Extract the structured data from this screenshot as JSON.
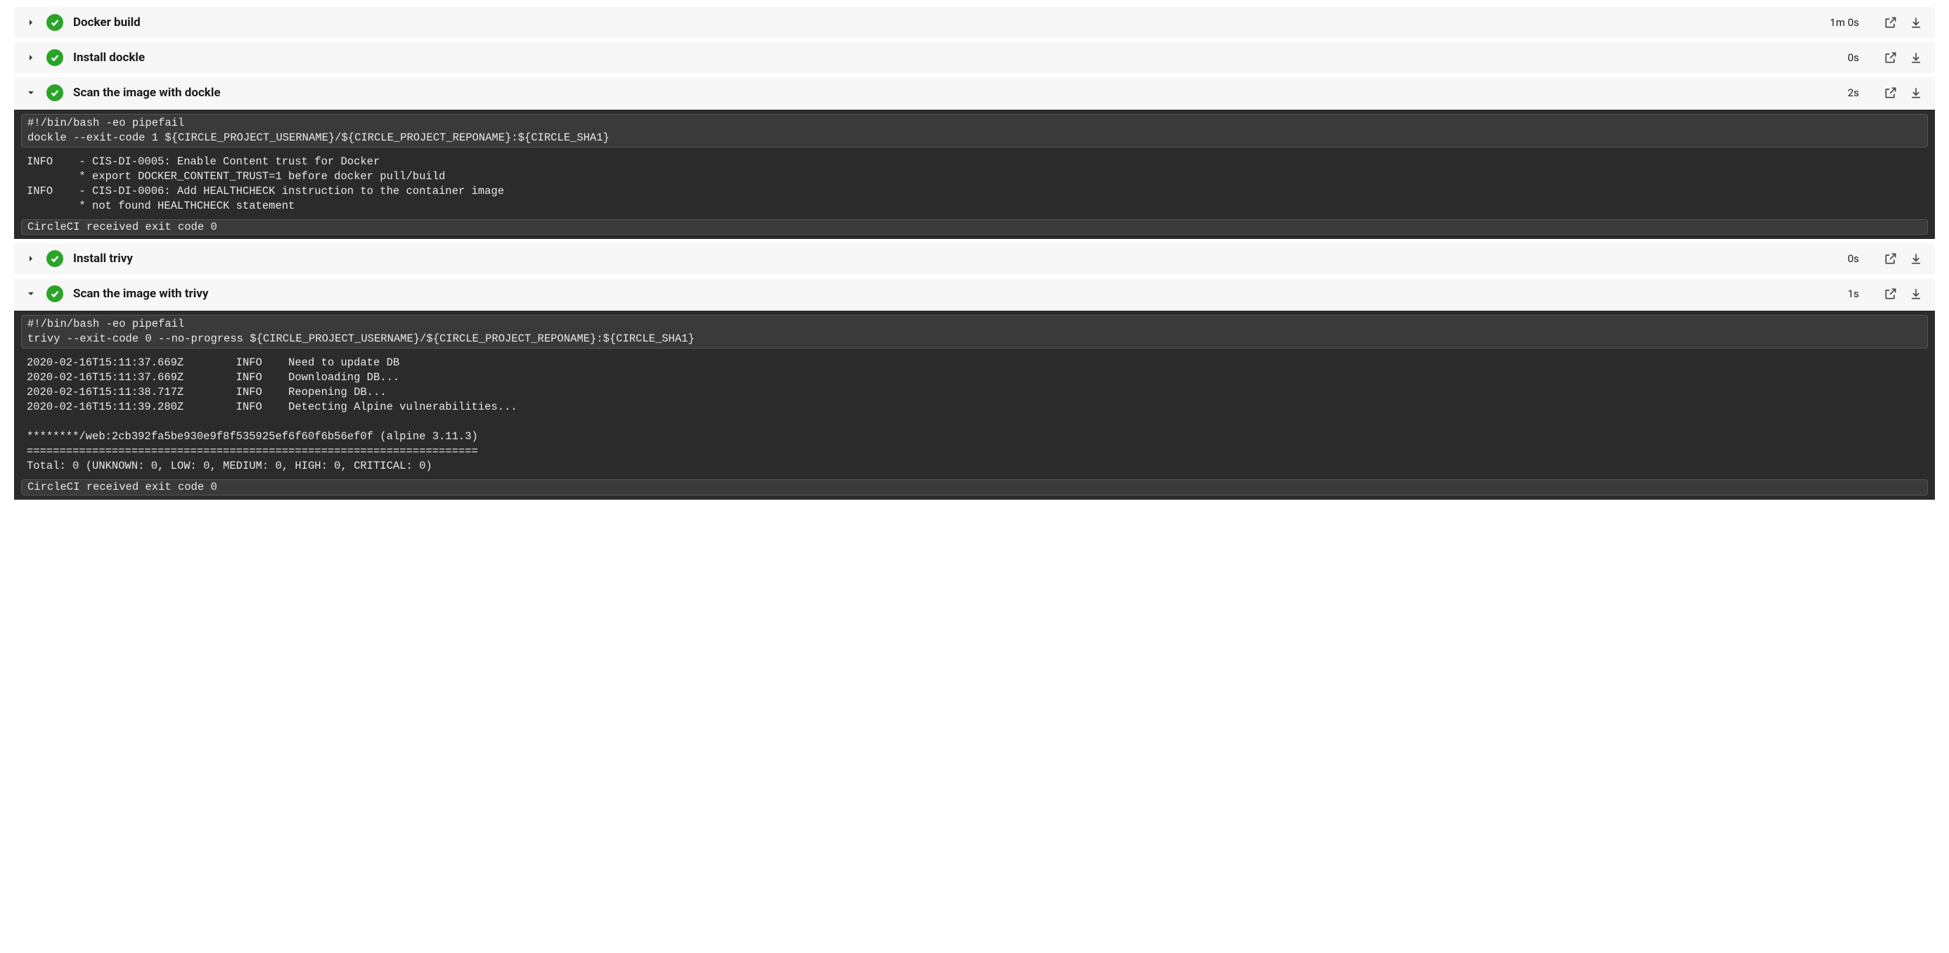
{
  "steps": [
    {
      "title": "Docker build",
      "duration": "1m 0s",
      "expanded": false
    },
    {
      "title": "Install dockle",
      "duration": "0s",
      "expanded": false
    },
    {
      "title": "Scan the image with dockle",
      "duration": "2s",
      "expanded": true,
      "command": "#!/bin/bash -eo pipefail\ndockle --exit-code 1 ${CIRCLE_PROJECT_USERNAME}/${CIRCLE_PROJECT_REPONAME}:${CIRCLE_SHA1}",
      "output": "INFO    - CIS-DI-0005: Enable Content trust for Docker\n        * export DOCKER_CONTENT_TRUST=1 before docker pull/build\nINFO    - CIS-DI-0006: Add HEALTHCHECK instruction to the container image\n        * not found HEALTHCHECK statement",
      "footer": "CircleCI received exit code 0"
    },
    {
      "title": "Install trivy",
      "duration": "0s",
      "expanded": false
    },
    {
      "title": "Scan the image with trivy",
      "duration": "1s",
      "expanded": true,
      "command": "#!/bin/bash -eo pipefail\ntrivy --exit-code 0 --no-progress ${CIRCLE_PROJECT_USERNAME}/${CIRCLE_PROJECT_REPONAME}:${CIRCLE_SHA1}",
      "output": "2020-02-16T15:11:37.669Z        INFO    Need to update DB\n2020-02-16T15:11:37.669Z        INFO    Downloading DB...\n2020-02-16T15:11:38.717Z        INFO    Reopening DB...\n2020-02-16T15:11:39.280Z        INFO    Detecting Alpine vulnerabilities...\n\n********/web:2cb392fa5be930e9f8f535925ef6f60f6b56ef0f (alpine 3.11.3)\n=====================================================================\nTotal: 0 (UNKNOWN: 0, LOW: 0, MEDIUM: 0, HIGH: 0, CRITICAL: 0)\n",
      "footer": "CircleCI received exit code 0"
    }
  ]
}
